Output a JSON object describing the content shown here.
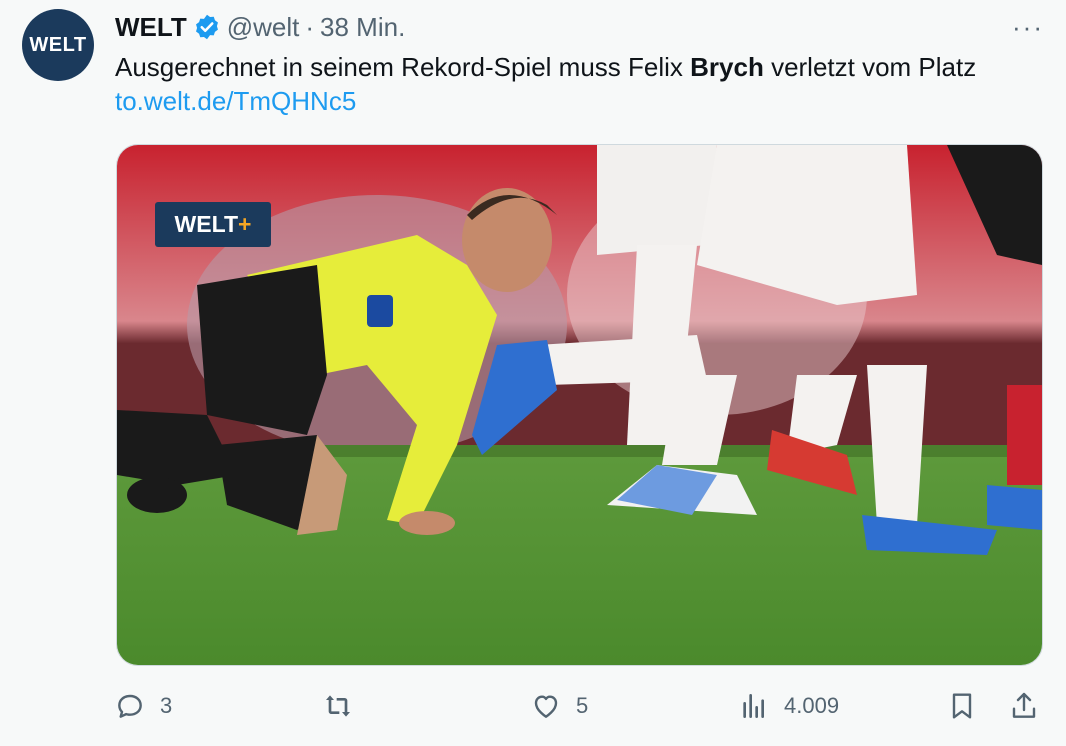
{
  "tweet": {
    "avatar_text": "WELT",
    "name": "WELT",
    "handle": "@welt",
    "separator": "·",
    "time": "38 Min.",
    "more": "···",
    "text_before": "Ausgerechnet in seinem Rekord-Spiel muss Felix ",
    "text_bold": "Brych",
    "text_after": " verletzt vom Platz",
    "link": "to.welt.de/TmQHNc5",
    "media": {
      "badge_text": "WELT",
      "badge_plus": "+"
    }
  },
  "actions": {
    "replies": "3",
    "retweets": "",
    "likes": "5",
    "views": "4.009"
  },
  "colors": {
    "accent": "#1d9bf0",
    "brand": "#1b3a5c",
    "muted": "#536471"
  }
}
